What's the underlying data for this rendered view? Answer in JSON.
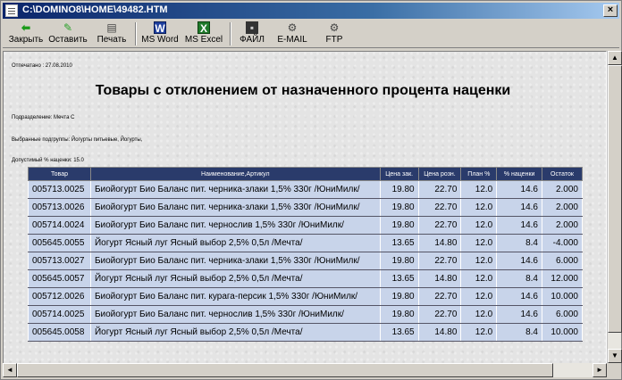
{
  "window": {
    "title": "C:\\DOMINO8\\HOME\\49482.HTM",
    "close_label": "×"
  },
  "toolbar": {
    "buttons": [
      {
        "label": "Закрыть",
        "icon": "back-arrow-icon"
      },
      {
        "label": "Оставить",
        "icon": "pin-icon"
      },
      {
        "label": "Печать",
        "icon": "printer-icon"
      },
      {
        "label": "MS Word",
        "icon": "word-icon"
      },
      {
        "label": "MS Excel",
        "icon": "excel-icon"
      },
      {
        "label": "ФАЙЛ",
        "icon": "disk-icon"
      },
      {
        "label": "E-MAIL",
        "icon": "gear-icon"
      },
      {
        "label": "FTP",
        "icon": "gear-icon"
      }
    ]
  },
  "report": {
    "printed": "Отпечатано : 27.08.2010",
    "title": "Товары с отклонением от назначенного процента наценки",
    "division": "Подразделение: Мечта С",
    "subgroups": "Выбранные подгруппы: Йогурты питьевые, Йогурты,",
    "allowed_markup": "Допустимый % наценки: 15.0"
  },
  "table": {
    "headers": [
      "Товар",
      "Наименование,Артикул",
      "Цена зак.",
      "Цена розн.",
      "План %",
      "% наценки",
      "Остаток"
    ],
    "rows": [
      [
        "005713.0025",
        "Биойогурт Био Баланс пит. черника-злаки 1,5% 330г /ЮниМилк/",
        "19.80",
        "22.70",
        "12.0",
        "14.6",
        "2.000"
      ],
      [
        "005713.0026",
        "Биойогурт Био Баланс пит. черника-злаки 1,5% 330г /ЮниМилк/",
        "19.80",
        "22.70",
        "12.0",
        "14.6",
        "2.000"
      ],
      [
        "005714.0024",
        "Биойогурт Био Баланс пит. чернослив 1,5% 330г /ЮниМилк/",
        "19.80",
        "22.70",
        "12.0",
        "14.6",
        "2.000"
      ],
      [
        "005645.0055",
        "Йогурт Ясный луг Ясный выбор 2,5% 0,5л /Мечта/",
        "13.65",
        "14.80",
        "12.0",
        "8.4",
        "-4.000"
      ],
      [
        "005713.0027",
        "Биойогурт Био Баланс пит. черника-злаки 1,5% 330г /ЮниМилк/",
        "19.80",
        "22.70",
        "12.0",
        "14.6",
        "6.000"
      ],
      [
        "005645.0057",
        "Йогурт Ясный луг Ясный выбор 2,5% 0,5л /Мечта/",
        "13.65",
        "14.80",
        "12.0",
        "8.4",
        "12.000"
      ],
      [
        "005712.0026",
        "Биойогурт Био Баланс пит. курага-персик 1,5% 330г /ЮниМилк/",
        "19.80",
        "22.70",
        "12.0",
        "14.6",
        "10.000"
      ],
      [
        "005714.0025",
        "Биойогурт Био Баланс пит. чернослив 1,5% 330г /ЮниМилк/",
        "19.80",
        "22.70",
        "12.0",
        "14.6",
        "6.000"
      ],
      [
        "005645.0058",
        "Йогурт Ясный луг Ясный выбор 2,5% 0,5л /Мечта/",
        "13.65",
        "14.80",
        "12.0",
        "8.4",
        "10.000"
      ]
    ]
  },
  "scroll": {
    "up": "▲",
    "down": "▼",
    "left": "◄",
    "right": "►"
  }
}
